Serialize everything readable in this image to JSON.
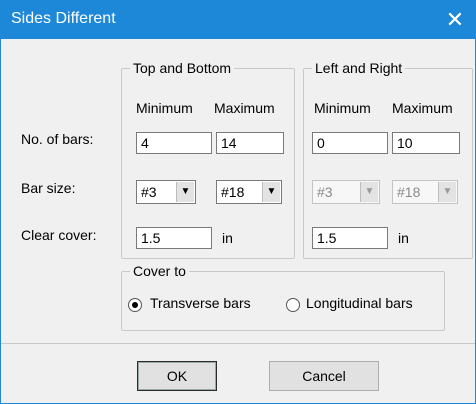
{
  "window": {
    "title": "Sides Different",
    "close_glyph": "✕"
  },
  "top_bottom": {
    "legend": "Top and Bottom",
    "min_header": "Minimum",
    "max_header": "Maximum",
    "bars_min": "4",
    "bars_max": "14",
    "size_min": "#3",
    "size_max": "#18",
    "cover": "1.5",
    "unit": "in"
  },
  "left_right": {
    "legend": "Left and Right",
    "min_header": "Minimum",
    "max_header": "Maximum",
    "bars_min": "0",
    "bars_max": "10",
    "size_min": "#3",
    "size_max": "#18",
    "cover": "1.5",
    "unit": "in"
  },
  "rows": {
    "bars": "No. of bars:",
    "size": "Bar size:",
    "cover": "Clear cover:"
  },
  "cover_to": {
    "legend": "Cover to",
    "options": [
      {
        "label": "Transverse bars",
        "selected": true
      },
      {
        "label": "Longitudinal bars",
        "selected": false
      }
    ]
  },
  "buttons": {
    "ok": "OK",
    "cancel": "Cancel"
  }
}
